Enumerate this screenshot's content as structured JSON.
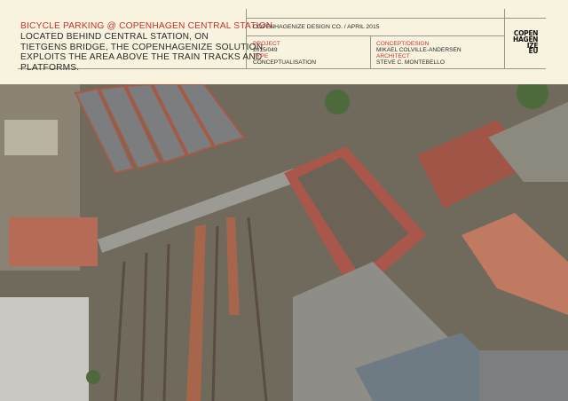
{
  "header": {
    "title": "BICYCLE PARKING @ COPENHAGEN CENTRAL STATION",
    "description_lines": [
      "LOCATED BEHIND CENTRAL STATION,  ON",
      "TIETGENS BRIDGE, THE COPENHAGENIZE SOLUTION",
      "EXPLOITS THE AREA ABOVE THE TRAIN TRACKS AND",
      "PLATFORMS."
    ],
    "company_date": "COPENHAGENIZE DESIGN CO.  / APRIL 2015",
    "project_label": "PROJECT",
    "project_value": "2015/049",
    "type_label": "TYPE",
    "type_value": "CONCEPTUALISATION",
    "concept_label": "CONCEPT/DESIGN",
    "concept_value": "MIKAEL COLVILLE-ANDERSEN",
    "architect_label": "ARCHITECT",
    "architect_value": "STEVE C. MONTEBELLO",
    "logo_text": [
      "COPEN",
      "HAGEN",
      "IZE",
      "EU"
    ]
  },
  "colors": {
    "accent": "#c8322e",
    "background": "#f8f3de"
  }
}
